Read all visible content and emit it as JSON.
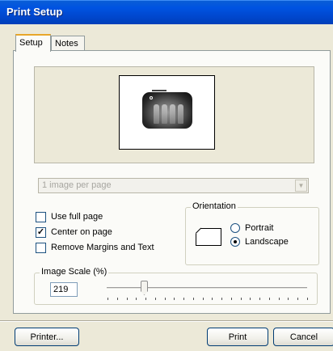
{
  "window": {
    "title": "Print Setup"
  },
  "tabs": [
    {
      "label": "Setup"
    },
    {
      "label": "Notes"
    }
  ],
  "layout_select": {
    "value": "1 image per page"
  },
  "options": {
    "use_full_page": {
      "label": "Use full page",
      "checked": false
    },
    "center_on_page": {
      "label": "Center on page",
      "checked": true
    },
    "remove_margins": {
      "label": "Remove Margins and Text",
      "checked": false
    }
  },
  "orientation": {
    "label": "Orientation",
    "portrait": "Portrait",
    "landscape": "Landscape",
    "selected": "Landscape"
  },
  "image_scale": {
    "label": "Image Scale (%)",
    "value": "219"
  },
  "buttons": {
    "printer": "Printer...",
    "print": "Print",
    "cancel": "Cancel"
  },
  "icons": {
    "preview": "xray-thumbnail-icon",
    "orientation": "page-landscape-icon",
    "dropdown": "chevron-down-icon"
  },
  "colors": {
    "title_bar": "#0053e1",
    "dialog_bg": "#ece9d8",
    "tab_highlight": "#e8a72b"
  }
}
